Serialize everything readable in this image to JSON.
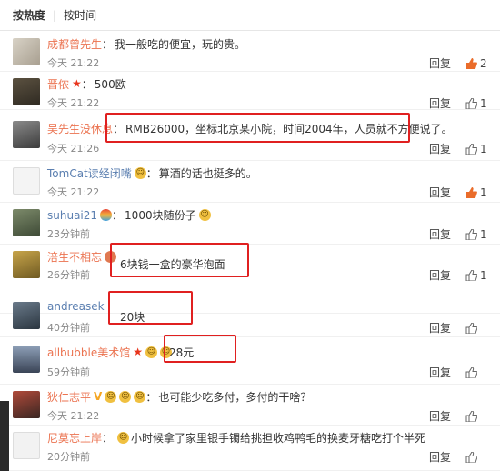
{
  "tabs": {
    "hot": "按热度",
    "separator": "|",
    "time": "按时间"
  },
  "labels": {
    "reply": "回复"
  },
  "comments": [
    {
      "user": "成都曾先生",
      "colon": "：",
      "text": "我一般吃的便宜，玩的贵。",
      "time": "今天 21:22",
      "likes": "2",
      "liked": true
    },
    {
      "user": "晋侬",
      "colon": "：",
      "text": "500欧",
      "time": "今天 21:22",
      "likes": "1",
      "liked": false
    },
    {
      "user": "吴先生没休息",
      "colon": "：",
      "text": "RMB26000，坐标北京某小院，时间2004年，人员就不方便说了。",
      "time": "今天 21:26",
      "likes": "1",
      "liked": false
    },
    {
      "user": "TomCat读经闭嘴",
      "colon": "：",
      "text": "算酒的话也挺多的。",
      "time": "今天 21:22",
      "likes": "1",
      "liked": true
    },
    {
      "user": "suhuai21",
      "colon": "：",
      "text": "1000块随份子",
      "time": "23分钟前",
      "likes": "1",
      "liked": false
    },
    {
      "user": "涪生不相忘",
      "colon": "：",
      "text": "6块钱一盒的豪华泡面",
      "time": "26分钟前",
      "likes": "1",
      "liked": false
    },
    {
      "user": "andreasek",
      "colon": "：",
      "text": "20块",
      "time": "40分钟前",
      "likes": "",
      "liked": false
    },
    {
      "user": "allbubble美术馆",
      "colon": "：",
      "text": "28元",
      "time": "59分钟前",
      "likes": "",
      "liked": false
    },
    {
      "user": "狄仁志平",
      "colon": "：",
      "text": "也可能少吃多付，多付的干啥？",
      "time": "今天 21:22",
      "likes": "",
      "liked": false
    },
    {
      "user": "尼莫忘上岸",
      "colon": "：",
      "text": "小时候拿了家里银手镯给挑担收鸡鸭毛的换麦牙糖吃打个半死",
      "time": "20分钟前",
      "likes": "",
      "liked": false
    }
  ],
  "colors": {
    "username": "#eb7350",
    "username_blue": "#5b7fb0",
    "highlight_box": "#e02020"
  }
}
